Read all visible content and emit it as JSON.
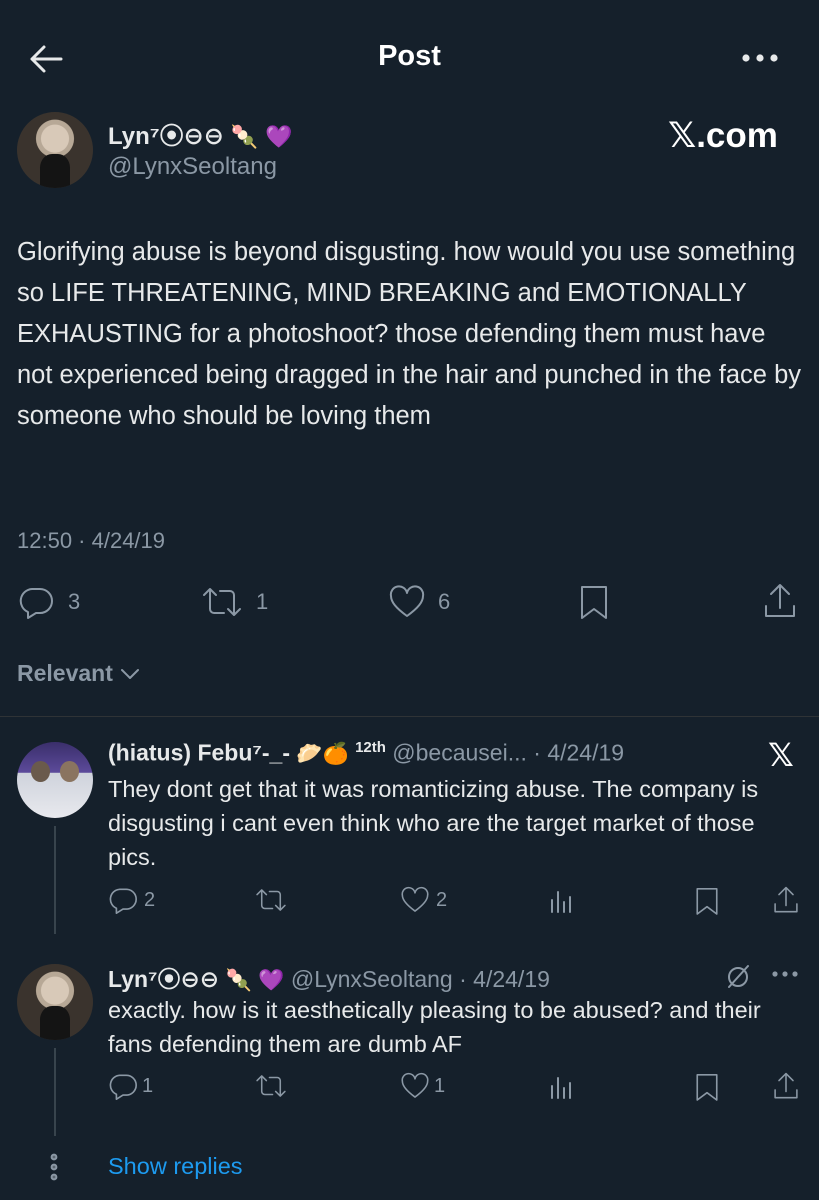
{
  "header": {
    "title": "Post",
    "back_icon": "arrow-left-icon",
    "more_icon": "more-horizontal-icon"
  },
  "main_post": {
    "author_name": "Lyn⁷⦿⊖⊖",
    "author_emojis": "🍡 💜",
    "author_handle": "@LynxSeoltang",
    "watermark": "𝕏.com",
    "text": "Glorifying abuse is beyond disgusting. how would you use something so LIFE THREATENING, MIND BREAKING and EMOTIONALLY EXHAUSTING for a photoshoot? those defending them must have not experienced being dragged in the hair and punched in the face by someone who should be loving them",
    "timestamp": "12:50 · 4/24/19",
    "stats": {
      "replies": "3",
      "reposts": "1",
      "likes": "6"
    }
  },
  "sort": {
    "label": "Relevant"
  },
  "replies": [
    {
      "author_name": "(hiatus) Febu⁷-_-",
      "author_emojis": "🥟🍊",
      "badge": "12th",
      "handle_date": "@becausei... · 4/24/19",
      "text": "They dont get that it was romanticizing abuse. The company is disgusting i cant even think who are the target market of those pics.",
      "stats": {
        "replies": "2",
        "reposts": "",
        "likes": "2"
      }
    },
    {
      "author_name": "Lyn⁷⦿⊖⊖",
      "author_emojis": "🍡 💜",
      "handle_date": "@LynxSeoltang · 4/24/19",
      "text": "exactly. how is it aesthetically pleasing to be abused? and their fans defending them are dumb AF",
      "stats": {
        "replies": "1",
        "reposts": "",
        "likes": "1"
      }
    }
  ],
  "show_replies": {
    "label": "Show replies"
  },
  "colors": {
    "background": "#15202b",
    "text": "#e7e9ea",
    "muted": "#8b98a5",
    "link": "#1d9bf0",
    "like_purple": "#a066ff"
  }
}
